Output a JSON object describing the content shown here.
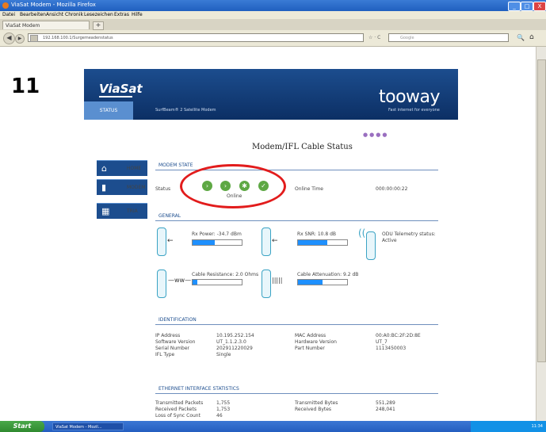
{
  "window": {
    "title": "ViaSat Modem - Mozilla Firefox",
    "buttons": {
      "minimize": "_",
      "maximize": "□",
      "close": "X"
    }
  },
  "menu": [
    "Datei",
    "Bearbeiten",
    "Ansicht",
    "Chronik",
    "Lesezeichen",
    "Extras",
    "Hilfe"
  ],
  "tab": {
    "label": "ViaSat Modem",
    "new_tab": "+"
  },
  "nav": {
    "url": "192.168.100.1/Surgemeadenstatus",
    "back": "◀",
    "forward": "▶",
    "url_right": "☆ · C",
    "search_placeholder": "Google",
    "search_icon": "🔍",
    "home_icon": "⌂"
  },
  "slide_number": "11",
  "header": {
    "logo": "ViaSat",
    "tab_status": "STATUS",
    "tab_modem": "SurfBeam® 2 Satellite Modem",
    "brand": "tooway",
    "brand_tagline": "Fast internet for everyone"
  },
  "leftnav": [
    {
      "label": "HOME",
      "icon": "⌂"
    },
    {
      "label": "MODEM",
      "icon": "▮"
    },
    {
      "label": "TRIA",
      "icon": "▦"
    }
  ],
  "page_title": "Modem/IFL Cable Status",
  "modem_state": {
    "section": "MODEM STATE",
    "status_label": "Status",
    "status_value": "Online",
    "online_time_label": "Online Time",
    "online_time_value": "000:00:00:22"
  },
  "general": {
    "section": "GENERAL",
    "rx_power": "Rx Power: -34.7 dBm",
    "rx_snr": "Rx SNR: 10.8 dB",
    "odu_label": "ODU Telemetry status:",
    "odu_value": "Active",
    "cable_resistance": "Cable Resistance: 2.0 Ohms",
    "cable_attenuation": "Cable Attenuation: 9.2 dB",
    "rx_power_fill": 0.45,
    "rx_snr_fill": 0.6,
    "cable_resistance_fill": 0.1,
    "cable_attenuation_fill": 0.5
  },
  "identification": {
    "section": "IDENTIFICATION",
    "rows_left": [
      {
        "label": "IP Address",
        "value": "10.195.252.154"
      },
      {
        "label": "Software Version",
        "value": "UT_1.1.2.3.0"
      },
      {
        "label": "Serial Number",
        "value": "202911220029"
      },
      {
        "label": "IFL Type",
        "value": "Single"
      }
    ],
    "rows_right": [
      {
        "label": "MAC Address",
        "value": "00:A0:BC:2F:2D:8E"
      },
      {
        "label": "Hardware Version",
        "value": "UT_7"
      },
      {
        "label": "Part Number",
        "value": "1113450003"
      }
    ]
  },
  "ethernet": {
    "section": "ETHERNET INTERFACE STATISTICS",
    "rows_left": [
      {
        "label": "Transmitted Packets",
        "value": "1,755"
      },
      {
        "label": "Received Packets",
        "value": "1,753"
      },
      {
        "label": "Loss of Sync Count",
        "value": "46"
      }
    ],
    "rows_right": [
      {
        "label": "Transmitted Bytes",
        "value": "551,289"
      },
      {
        "label": "Received Bytes",
        "value": "248,041"
      }
    ]
  },
  "taskbar": {
    "start": "Start",
    "item": "ViaSat Modem - Mozil...",
    "clock": "11:34"
  },
  "colors": {
    "header_blue": "#1c4d8e",
    "accent_blue": "#5a8fd0",
    "status_green": "#5ea844",
    "highlight_red": "#e21c1c",
    "bar_fill": "#1e90ff"
  }
}
